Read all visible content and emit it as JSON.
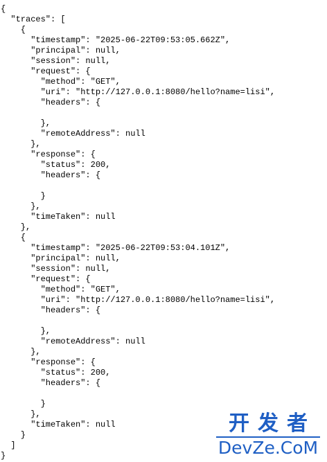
{
  "lines": [
    "{",
    "  \"traces\": [",
    "    {",
    "      \"timestamp\": \"2025-06-22T09:53:05.662Z\",",
    "      \"principal\": null,",
    "      \"session\": null,",
    "      \"request\": {",
    "        \"method\": \"GET\",",
    "        \"uri\": \"http://127.0.0.1:8080/hello?name=lisi\",",
    "        \"headers\": {",
    "",
    "        },",
    "        \"remoteAddress\": null",
    "      },",
    "      \"response\": {",
    "        \"status\": 200,",
    "        \"headers\": {",
    "",
    "        }",
    "      },",
    "      \"timeTaken\": null",
    "    },",
    "    {",
    "      \"timestamp\": \"2025-06-22T09:53:04.101Z\",",
    "      \"principal\": null,",
    "      \"session\": null,",
    "      \"request\": {",
    "        \"method\": \"GET\",",
    "        \"uri\": \"http://127.0.0.1:8080/hello?name=lisi\",",
    "        \"headers\": {",
    "",
    "        },",
    "        \"remoteAddress\": null",
    "      },",
    "      \"response\": {",
    "        \"status\": 200,",
    "        \"headers\": {",
    "",
    "        }",
    "      },",
    "      \"timeTaken\": null",
    "    }",
    "  ]",
    "}"
  ],
  "watermark": {
    "top": "开发者",
    "bottom": "DevZe.CoM"
  }
}
